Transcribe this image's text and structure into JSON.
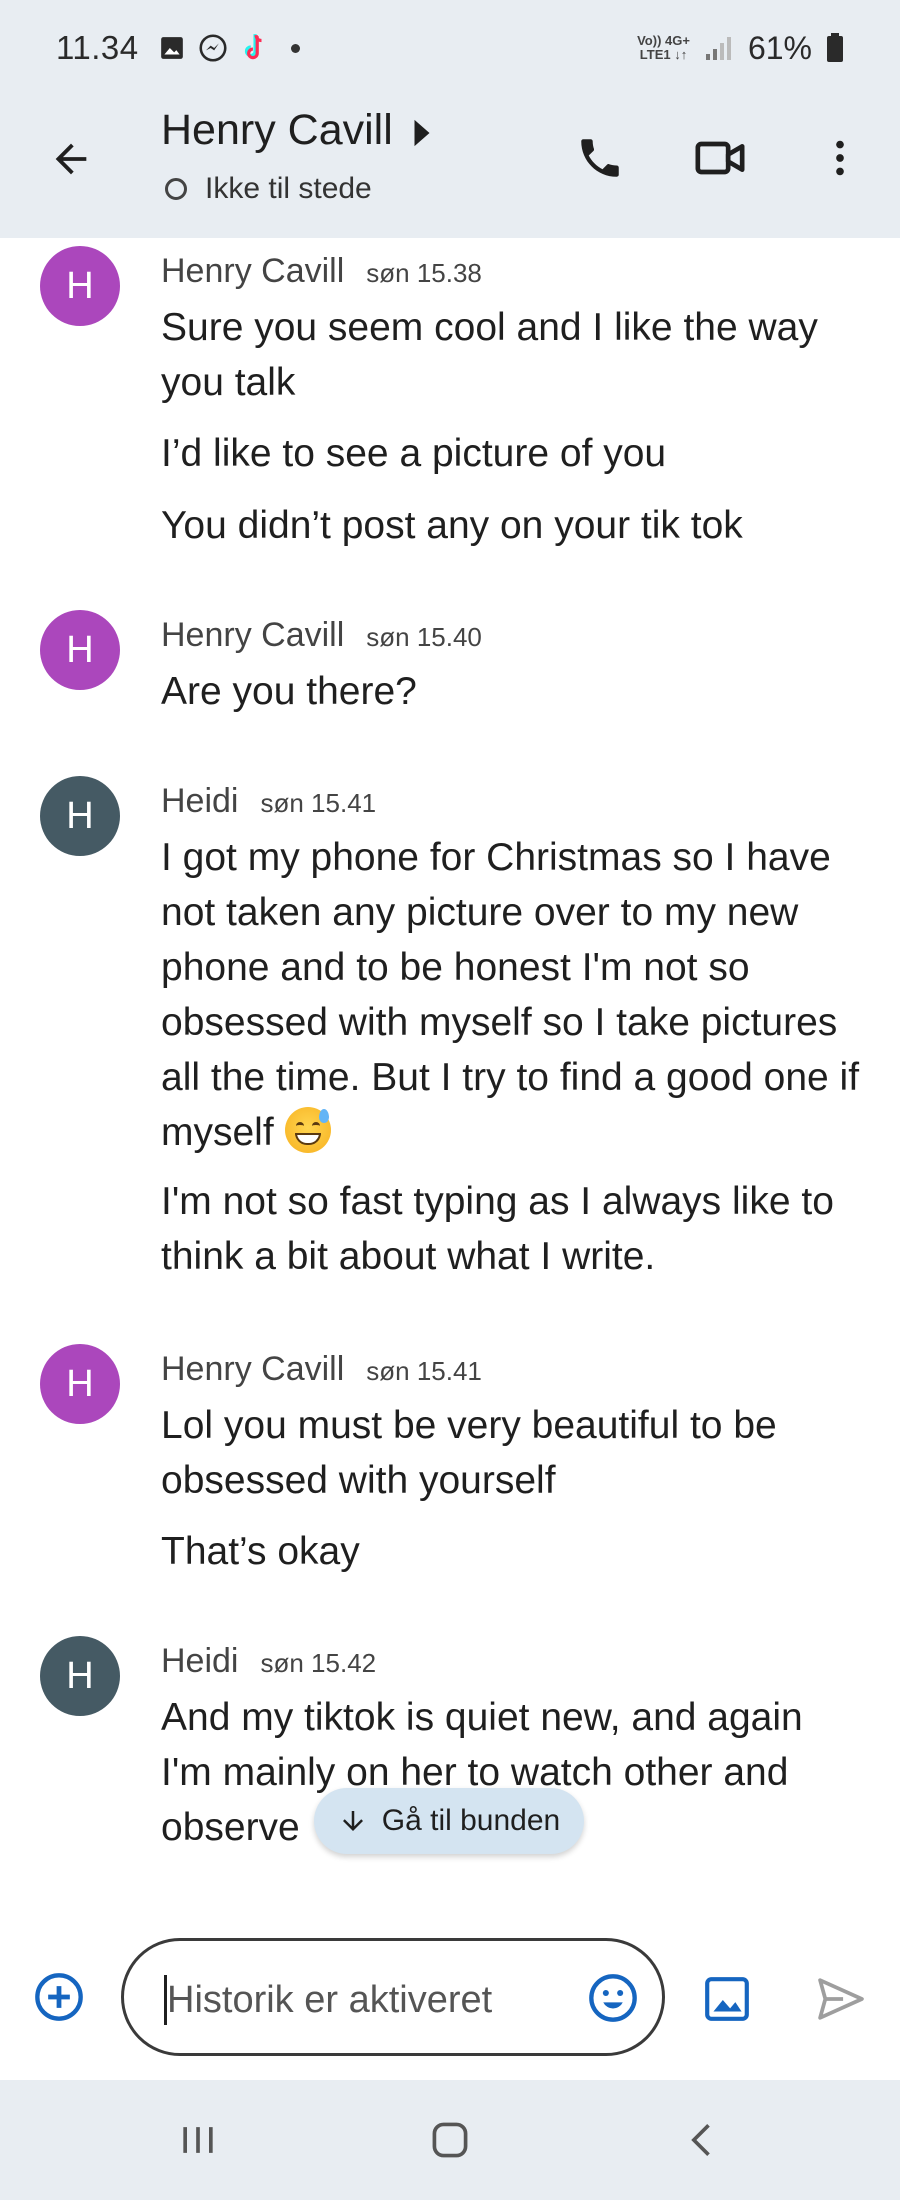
{
  "status_bar": {
    "time": "11.34",
    "network_top": "Vo)) 4G+",
    "network_bottom": "LTE1 ↓↑",
    "battery": "61%"
  },
  "header": {
    "contact_name": "Henry Cavill",
    "presence": "Ikke til stede"
  },
  "messages": [
    {
      "sender": "Henry Cavill",
      "time": "søn 15.38",
      "avatar_letter": "H",
      "avatar_color": "#ab47bc",
      "lines": [
        "Sure you seem cool and I like the way you talk",
        "I’d like to see a picture of you",
        "You didn’t post any on your tik tok"
      ]
    },
    {
      "sender": "Henry Cavill",
      "time": "søn 15.40",
      "avatar_letter": "H",
      "avatar_color": "#ab47bc",
      "lines": [
        "Are you there?"
      ]
    },
    {
      "sender": "Heidi",
      "time": "søn 15.41",
      "avatar_letter": "H",
      "avatar_color": "#455a64",
      "lines": [
        "I got my phone for Christmas so I have not taken any picture over to my new phone and to be honest I'm not so obsessed with myself so I take pictures all the time. But I try to find a good one if myself",
        "I'm not so fast typing as I always like to think a bit about what I write."
      ],
      "emoji": "grinning-face-with-sweat"
    },
    {
      "sender": "Henry Cavill",
      "time": "søn 15.41",
      "avatar_letter": "H",
      "avatar_color": "#ab47bc",
      "lines": [
        "Lol you must be very beautiful to be obsessed with yourself",
        "That’s okay"
      ]
    },
    {
      "sender": "Heidi",
      "time": "søn 15.42",
      "avatar_letter": "H",
      "avatar_color": "#455a64",
      "lines": [
        "And my tiktok is quiet new, and again I'm mainly on her to watch other and observe"
      ]
    }
  ],
  "jump_chip": {
    "label": "Gå til bunden"
  },
  "compose": {
    "placeholder": "Historik er aktiveret"
  },
  "icons": {
    "back": "arrow-back-icon",
    "call": "phone-icon",
    "video": "video-camera-icon",
    "more": "more-vert-icon",
    "add": "add-circle-icon",
    "emoji": "emoji-icon",
    "gallery": "image-icon",
    "send": "send-icon"
  },
  "colors": {
    "header_bg": "#e8edf2",
    "chip_bg": "#d4e4f1",
    "accent": "#1565c0"
  }
}
